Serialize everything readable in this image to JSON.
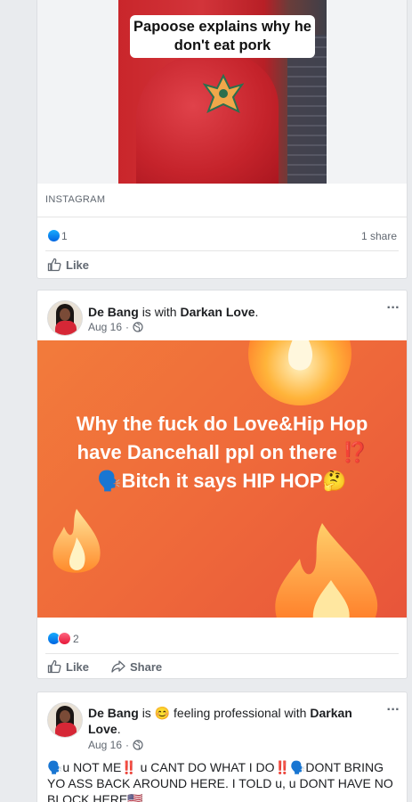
{
  "post1": {
    "video_caption": "Papoose explains why he don't eat pork",
    "link_source": "INSTAGRAM",
    "reaction_count": "1",
    "share_count": "1 share",
    "like_label": "Like"
  },
  "post2": {
    "author": "De Bang",
    "with_text": "is with",
    "tagged": "Darkan Love",
    "date": "Aug 16",
    "separator": "·",
    "more": "···",
    "body_text": "Why the fuck do Love&Hip Hop have Dancehall ppl on there ⁉️🗣️Bitch it says HIP HOP🤔",
    "reaction_count": "2",
    "like_label": "Like",
    "share_label": "Share",
    "background_color": "#ef6a3a"
  },
  "post3": {
    "author": "De Bang",
    "is_text": "is",
    "feeling_emoji": "😊",
    "feeling_text": "feeling professional with",
    "tagged": "Darkan Love",
    "date": "Aug 16",
    "separator": "·",
    "more": "···",
    "status": "🗣️u NOT ME‼️ u CANT DO WHAT I DO‼️🗣️DONT BRING YO ASS BACK AROUND HERE. I TOLD u, u DONT HAVE NO BLOCK HERE🇺🇸"
  },
  "colors": {
    "feed_bg": "#e9ebee",
    "like_blue": "#1877f2",
    "love_red": "#e61739",
    "meta_gray": "#606770"
  }
}
